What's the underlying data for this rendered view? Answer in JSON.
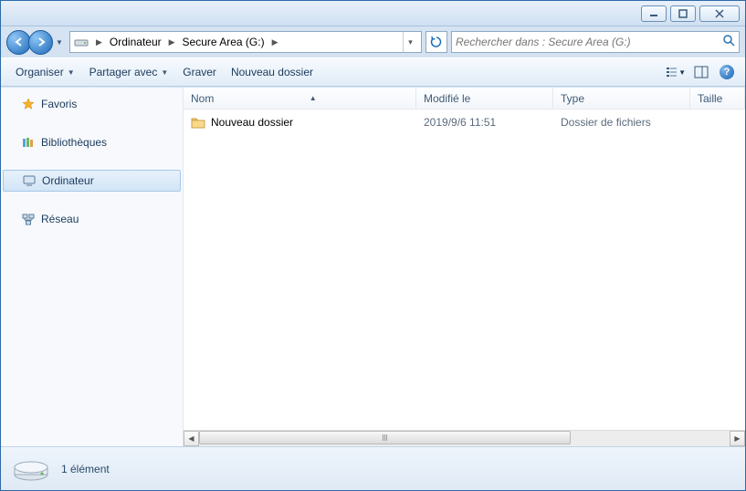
{
  "breadcrumb": {
    "parts": [
      "Ordinateur",
      "Secure Area (G:)"
    ]
  },
  "search": {
    "placeholder": "Rechercher dans : Secure Area (G:)"
  },
  "toolbar": {
    "organize": "Organiser",
    "share": "Partager avec",
    "burn": "Graver",
    "newfolder": "Nouveau dossier"
  },
  "sidebar": {
    "favorites": "Favoris",
    "libraries": "Bibliothèques",
    "computer": "Ordinateur",
    "network": "Réseau"
  },
  "columns": {
    "name": "Nom",
    "modified": "Modifié le",
    "type": "Type",
    "size": "Taille"
  },
  "rows": [
    {
      "name": "Nouveau dossier",
      "modified": "2019/9/6 11:51",
      "type": "Dossier de fichiers",
      "size": ""
    }
  ],
  "status": {
    "count": "1 élément"
  }
}
